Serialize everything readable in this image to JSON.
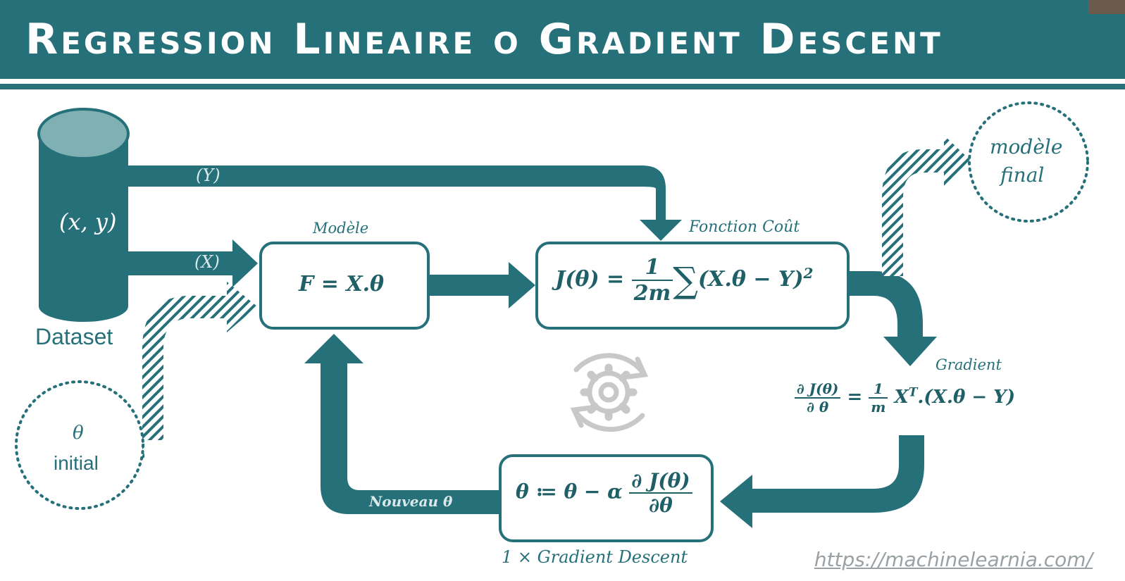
{
  "title": "Regression Lineaire o Gradient Descent",
  "dataset": {
    "label": "Dataset",
    "content": "(x, y)",
    "y_arrow_label": "(Y)",
    "x_arrow_label": "(X)"
  },
  "theta_initial": {
    "symbol": "θ",
    "label": "initial"
  },
  "model": {
    "caption": "Modèle",
    "formula": "F = X.θ"
  },
  "cost": {
    "caption": "Fonction Coût",
    "lhs": "J(θ) =",
    "frac_num": "1",
    "frac_den": "2m",
    "sigma": "∑",
    "rhs": "(X.θ  − Y)",
    "power": "2"
  },
  "gradient": {
    "caption": "Gradient",
    "lhs_num": "∂ J(θ)",
    "lhs_den": "∂ θ",
    "eq": "=",
    "frac_num": "1",
    "frac_den": "m",
    "xt": "X",
    "xt_sup": "T",
    "rhs": ".(X.θ − Y)"
  },
  "update": {
    "lhs": "θ ≔ θ −  α",
    "frac_num": "∂ J(θ)",
    "frac_den": "∂θ",
    "caption": "1 × Gradient Descent",
    "loop_label": "Nouveau θ"
  },
  "final_model": {
    "line1": "modèle",
    "line2": "final"
  },
  "url": "https://machinelearnia.com/",
  "colors": {
    "teal": "#257079",
    "text_dark": "#1f5f67",
    "gear": "#c8c8c8"
  }
}
